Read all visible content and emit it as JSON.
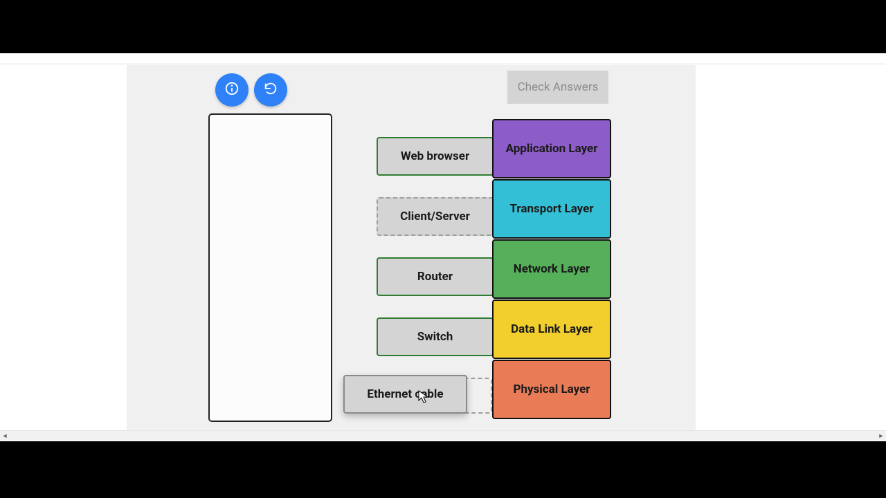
{
  "toolbar": {
    "check_label": "Check Answers"
  },
  "layers": [
    {
      "label": "Application Layer",
      "color": "#8c5cc8"
    },
    {
      "label": "Transport Layer",
      "color": "#33c0d6"
    },
    {
      "label": "Network Layer",
      "color": "#56b05a"
    },
    {
      "label": "Data Link Layer",
      "color": "#f3cf2d"
    },
    {
      "label": "Physical Layer",
      "color": "#ea7b57"
    }
  ],
  "drops": [
    {
      "label": "Web browser",
      "state": "placed"
    },
    {
      "label": "Client/Server",
      "state": "placed-dashed"
    },
    {
      "label": "Router",
      "state": "placed"
    },
    {
      "label": "Switch",
      "state": "placed"
    },
    {
      "label": "",
      "state": "empty-dashed"
    }
  ],
  "dragging": {
    "label": "Ethernet cable"
  }
}
